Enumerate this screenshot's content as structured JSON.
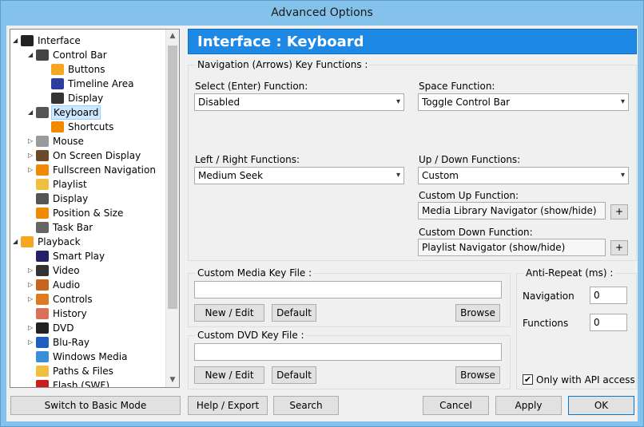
{
  "window": {
    "title": "Advanced Options"
  },
  "tree": {
    "items": [
      {
        "label": "Interface",
        "depth": 0,
        "exp": "◢",
        "icon": "monitor-icon",
        "color": "#222222"
      },
      {
        "label": "Control Bar",
        "depth": 1,
        "exp": "◢",
        "icon": "control-bar-icon",
        "color": "#444444"
      },
      {
        "label": "Buttons",
        "depth": 2,
        "exp": "",
        "icon": "orange-button-icon",
        "color": "#f5a623"
      },
      {
        "label": "Timeline Area",
        "depth": 2,
        "exp": "",
        "icon": "timeline-icon",
        "color": "#2d3e9c"
      },
      {
        "label": "Display",
        "depth": 2,
        "exp": "",
        "icon": "display-icon",
        "color": "#333333"
      },
      {
        "label": "Keyboard",
        "depth": 1,
        "exp": "◢",
        "icon": "keyboard-icon",
        "color": "#555555",
        "selected": true
      },
      {
        "label": "Shortcuts",
        "depth": 2,
        "exp": "",
        "icon": "shortcut-arrow-icon",
        "color": "#f08a00"
      },
      {
        "label": "Mouse",
        "depth": 1,
        "exp": "▷",
        "icon": "mouse-icon",
        "color": "#9a9a9a"
      },
      {
        "label": "On Screen Display",
        "depth": 1,
        "exp": "▷",
        "icon": "osd-icon",
        "color": "#6b4a2b"
      },
      {
        "label": "Fullscreen Navigation",
        "depth": 1,
        "exp": "▷",
        "icon": "fullscreen-icon",
        "color": "#f08a00"
      },
      {
        "label": "Playlist",
        "depth": 1,
        "exp": "",
        "icon": "playlist-icon",
        "color": "#f0c040"
      },
      {
        "label": "Display",
        "depth": 1,
        "exp": "",
        "icon": "display-icon",
        "color": "#555555"
      },
      {
        "label": "Position & Size",
        "depth": 1,
        "exp": "",
        "icon": "position-icon",
        "color": "#f08a00"
      },
      {
        "label": "Task Bar",
        "depth": 1,
        "exp": "",
        "icon": "taskbar-icon",
        "color": "#666666"
      },
      {
        "label": "Playback",
        "depth": 0,
        "exp": "◢",
        "icon": "playback-icon",
        "color": "#f5a623"
      },
      {
        "label": "Smart Play",
        "depth": 1,
        "exp": "",
        "icon": "smart-play-icon",
        "color": "#222266"
      },
      {
        "label": "Video",
        "depth": 1,
        "exp": "▷",
        "icon": "video-icon",
        "color": "#333333"
      },
      {
        "label": "Audio",
        "depth": 1,
        "exp": "▷",
        "icon": "audio-icon",
        "color": "#c8641e"
      },
      {
        "label": "Controls",
        "depth": 1,
        "exp": "▷",
        "icon": "controls-icon",
        "color": "#e07a20"
      },
      {
        "label": "History",
        "depth": 1,
        "exp": "",
        "icon": "history-icon",
        "color": "#d9705a"
      },
      {
        "label": "DVD",
        "depth": 1,
        "exp": "▷",
        "icon": "dvd-icon",
        "color": "#222222"
      },
      {
        "label": "Blu-Ray",
        "depth": 1,
        "exp": "▷",
        "icon": "bluray-icon",
        "color": "#1f5fbf"
      },
      {
        "label": "Windows Media",
        "depth": 1,
        "exp": "",
        "icon": "windows-media-icon",
        "color": "#3a8fd8"
      },
      {
        "label": "Paths & Files",
        "depth": 1,
        "exp": "",
        "icon": "folder-icon",
        "color": "#f0c040"
      },
      {
        "label": "Flash (SWF)",
        "depth": 1,
        "exp": "",
        "icon": "flash-icon",
        "color": "#c81e1e"
      }
    ]
  },
  "header": {
    "title": "Interface : Keyboard"
  },
  "nav_group": {
    "title": "Navigation (Arrows) Key Functions :",
    "select_label": "Select (Enter) Function:",
    "select_value": "Disabled",
    "space_label": "Space Function:",
    "space_value": "Toggle Control Bar",
    "leftright_label": "Left / Right Functions:",
    "leftright_value": "Medium Seek",
    "updown_label": "Up / Down Functions:",
    "updown_value": "Custom",
    "custom_up_label": "Custom Up Function:",
    "custom_up_value": "Media Library Navigator (show/hide)",
    "custom_down_label": "Custom Down Function:",
    "custom_down_value": "Playlist Navigator (show/hide)",
    "plus": "+"
  },
  "media_key": {
    "title": "Custom Media Key File :",
    "value": "",
    "new_edit": "New / Edit",
    "default": "Default",
    "browse": "Browse"
  },
  "dvd_key": {
    "title": "Custom DVD Key File :",
    "value": "",
    "new_edit": "New / Edit",
    "default": "Default",
    "browse": "Browse"
  },
  "anti_repeat": {
    "title": "Anti-Repeat (ms) :",
    "navigation_label": "Navigation",
    "navigation_value": "0",
    "functions_label": "Functions",
    "functions_value": "0",
    "api_label": "Only with API access",
    "api_checked": "✔"
  },
  "footer": {
    "basic_mode": "Switch to Basic Mode",
    "help_export": "Help / Export",
    "search": "Search",
    "cancel": "Cancel",
    "apply": "Apply",
    "ok": "OK"
  },
  "colors": {
    "accent": "#1e88e5",
    "titlebar": "#84c1eb"
  }
}
